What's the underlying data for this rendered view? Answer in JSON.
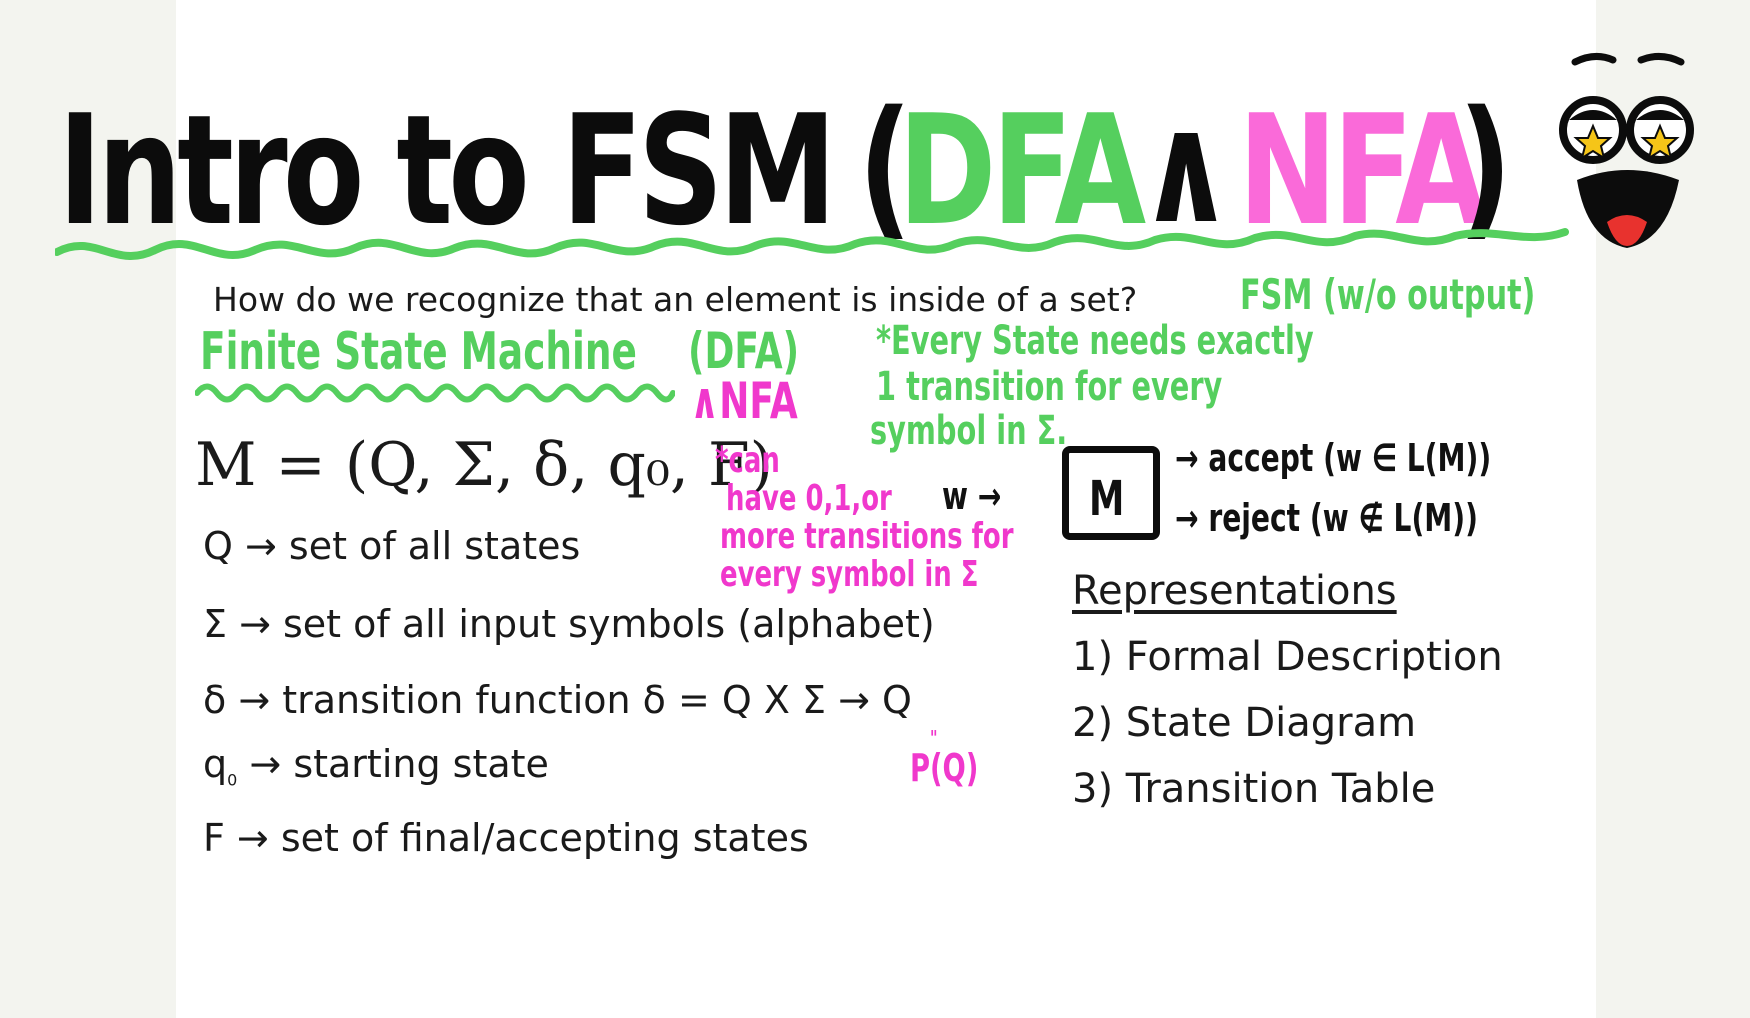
{
  "title": {
    "prefix": "Intro to FSM",
    "open_paren": "(",
    "dfa": "DFA",
    "and_symbol": "∧",
    "nfa": "NFA",
    "close_paren": ")"
  },
  "question": "How do we recognize that an element is inside of a set?",
  "fsm_note": "FSM (w/o output)",
  "finite_state_machine": "Finite State Machine",
  "dfa_label": "(DFA)",
  "nfa_label": "∧NFA",
  "dfa_note": {
    "line1": "*Every State needs exactly",
    "line2": "1 transition for every",
    "line3": "symbol in Σ."
  },
  "nfa_note": {
    "line1": "*can",
    "line2": "have 0,1,or",
    "line3": "more transitions for",
    "line4": "every symbol in Σ"
  },
  "formal_tuple": "M = (Q, Σ, δ, q₀, F)",
  "definitions": {
    "q": "Q → set of all states",
    "sigma": "Σ → set of all input symbols (alphabet)",
    "delta": "δ → transition function δ = Q X Σ → Q",
    "q0_symbol": "q",
    "q0_sub": "0",
    "q0_text": "→ starting state",
    "f": "F → set of final/accepting states"
  },
  "power_set_note": "P(Q)",
  "machine_diagram": {
    "input": "w →",
    "box": "M",
    "accept": "→ accept (w ∈ L(M))",
    "reject": "→ reject (w ∉ L(M))"
  },
  "representations": {
    "heading": "Representations",
    "items": [
      "1) Formal Description",
      "2) State Diagram",
      "3) Transition Table"
    ]
  },
  "colors": {
    "green": "#55cf5e",
    "pink": "#f038cc",
    "black": "#0c0c0c",
    "star": "#f5c518",
    "tongue": "#e8322e"
  }
}
